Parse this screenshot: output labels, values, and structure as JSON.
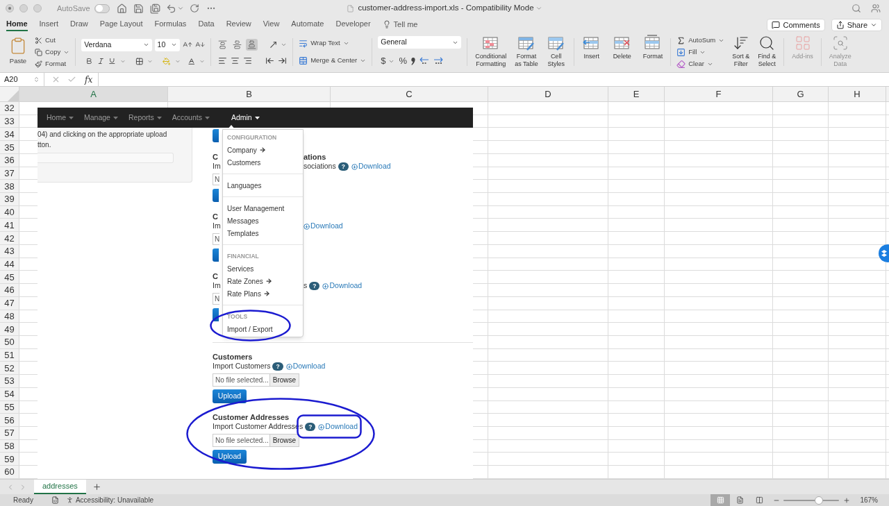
{
  "window": {
    "title": "customer-address-import.xls - Compatibility Mode",
    "autosave_label": "AutoSave",
    "autosave_on": false
  },
  "ribbon_tabs": [
    {
      "label": "Home",
      "selected": true
    },
    {
      "label": "Insert",
      "selected": false
    },
    {
      "label": "Draw",
      "selected": false
    },
    {
      "label": "Page Layout",
      "selected": false
    },
    {
      "label": "Formulas",
      "selected": false
    },
    {
      "label": "Data",
      "selected": false
    },
    {
      "label": "Review",
      "selected": false
    },
    {
      "label": "View",
      "selected": false
    },
    {
      "label": "Automate",
      "selected": false
    },
    {
      "label": "Developer",
      "selected": false
    }
  ],
  "tell_me": "Tell me",
  "comments_button": "Comments",
  "share_button": "Share",
  "ribbon": {
    "clipboard": {
      "paste": "Paste",
      "cut": "Cut",
      "copy": "Copy",
      "format": "Format"
    },
    "font": {
      "name": "Verdana",
      "size": "10"
    },
    "alignment": {
      "vertical": [
        {
          "selected": false
        },
        {
          "selected": false
        },
        {
          "selected": true
        }
      ],
      "wrap_text": "Wrap Text",
      "merge": "Merge & Center"
    },
    "number": {
      "format": "General",
      "currency": "$",
      "percent": "%"
    },
    "styles": [
      "Conditional\nFormatting",
      "Format\nas Table",
      "Cell\nStyles"
    ],
    "cells": [
      "Insert",
      "Delete",
      "Format"
    ],
    "editing": {
      "autosum": "AutoSum",
      "fill": "Fill",
      "clear": "Clear",
      "sort": "Sort &\nFilter",
      "find": "Find &\nSelect"
    },
    "extras": [
      {
        "label": "Add-ins",
        "disabled": true
      },
      {
        "label": "Analyze\nData",
        "disabled": true
      }
    ]
  },
  "formula_bar": {
    "name_box": "A20",
    "fx": "fx"
  },
  "columns": [
    {
      "letter": "A",
      "selected": true
    },
    {
      "letter": "B",
      "selected": false
    },
    {
      "letter": "C",
      "selected": false
    },
    {
      "letter": "D",
      "selected": false
    },
    {
      "letter": "E",
      "selected": false
    },
    {
      "letter": "F",
      "selected": false
    },
    {
      "letter": "G",
      "selected": false
    },
    {
      "letter": "H",
      "selected": false
    }
  ],
  "rows": [
    "32",
    "33",
    "34",
    "35",
    "36",
    "37",
    "38",
    "39",
    "40",
    "41",
    "42",
    "43",
    "44",
    "45",
    "46",
    "47",
    "48",
    "49",
    "50",
    "51",
    "52",
    "53",
    "54",
    "55",
    "56",
    "57",
    "58",
    "59",
    "60"
  ],
  "embedded_page": {
    "nav": [
      {
        "label": "Home",
        "selected": false
      },
      {
        "label": "Manage",
        "selected": false
      },
      {
        "label": "Reports",
        "selected": false
      },
      {
        "label": "Accounts",
        "selected": false
      },
      {
        "label": "Admin",
        "selected": true
      }
    ],
    "intro_lines": [
      "04) and clicking on the appropriate upload",
      "tton."
    ],
    "partial_sections": [
      {
        "heading_start": "C",
        "heading_end": "ations",
        "label_start": "Im",
        "label_end": "sociations",
        "help": "?",
        "download": "Download",
        "field_start": "N"
      },
      {
        "heading_start": "C",
        "label_start": "Im",
        "download": "Download",
        "field_start": "N"
      },
      {
        "heading_start": "C",
        "label_start": "Im",
        "label_end": "s",
        "help": "?",
        "download": "Download",
        "field_start": "N"
      }
    ],
    "sections": [
      {
        "heading": "Customers",
        "label": "Import Customers",
        "help": "?",
        "download": "Download",
        "file_placeholder": "No file selected...",
        "browse": "Browse",
        "upload": "Upload"
      },
      {
        "heading": "Customer Addresses",
        "label": "Import Customer Addresses",
        "help": "?",
        "download": "Download",
        "file_placeholder": "No file selected...",
        "browse": "Browse",
        "upload": "Upload"
      }
    ],
    "menu": [
      {
        "kind": "header",
        "label": "CONFIGURATION"
      },
      {
        "kind": "item",
        "label": "Company",
        "submenu": true
      },
      {
        "kind": "item",
        "label": "Customers",
        "submenu": false
      },
      {
        "kind": "divider"
      },
      {
        "kind": "item",
        "label": "Languages",
        "submenu": false
      },
      {
        "kind": "divider"
      },
      {
        "kind": "item",
        "label": "User Management",
        "submenu": false
      },
      {
        "kind": "item",
        "label": "Messages",
        "submenu": false
      },
      {
        "kind": "item",
        "label": "Templates",
        "submenu": false
      },
      {
        "kind": "divider"
      },
      {
        "kind": "header",
        "label": "FINANCIAL"
      },
      {
        "kind": "item",
        "label": "Services",
        "submenu": false
      },
      {
        "kind": "item",
        "label": "Rate Zones",
        "submenu": true
      },
      {
        "kind": "item",
        "label": "Rate Plans",
        "submenu": true
      },
      {
        "kind": "divider"
      },
      {
        "kind": "header",
        "label": "TOOLS"
      },
      {
        "kind": "item",
        "label": "Import / Export",
        "submenu": false
      }
    ],
    "annotations": [
      {
        "kind": "ellipse"
      },
      {
        "kind": "ellipse"
      },
      {
        "kind": "rounded_rect"
      }
    ]
  },
  "sheet_tabs": [
    {
      "label": "addresses",
      "selected": true
    }
  ],
  "status_bar": {
    "status": "Ready",
    "accessibility": "Accessibility: Unavailable",
    "views": [
      {
        "kind": "normal",
        "selected": true
      },
      {
        "kind": "page_layout",
        "selected": false
      },
      {
        "kind": "page_break",
        "selected": false
      }
    ],
    "zoom": {
      "level": 0.63,
      "reading": "167%"
    }
  }
}
